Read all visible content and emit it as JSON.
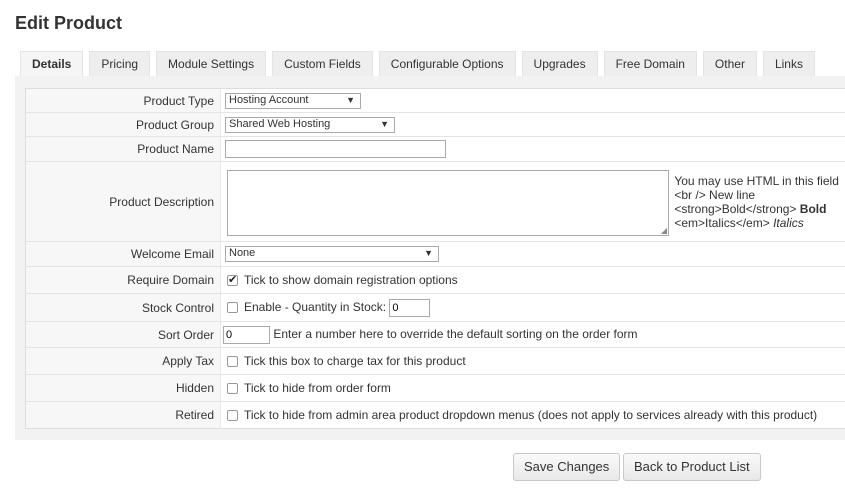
{
  "page": {
    "title": "Edit Product"
  },
  "tabs": [
    "Details",
    "Pricing",
    "Module Settings",
    "Custom Fields",
    "Configurable Options",
    "Upgrades",
    "Free Domain",
    "Other",
    "Links"
  ],
  "form": {
    "product_type": {
      "label": "Product Type",
      "value": "Hosting Account"
    },
    "product_group": {
      "label": "Product Group",
      "value": "Shared Web Hosting"
    },
    "product_name": {
      "label": "Product Name",
      "value": ""
    },
    "product_description": {
      "label": "Product Description",
      "value": "",
      "hint_line1": "You may use HTML in this field",
      "hint_line2": "<br /> New line",
      "hint_line3_code": "<strong>Bold</strong>",
      "hint_line3_bold": "Bold",
      "hint_line4_code": "<em>Italics</em>",
      "hint_line4_italic": "Italics"
    },
    "welcome_email": {
      "label": "Welcome Email",
      "value": "None"
    },
    "require_domain": {
      "label": "Require Domain",
      "checked": true,
      "text": "Tick to show domain registration options"
    },
    "stock_control": {
      "label": "Stock Control",
      "checked": false,
      "text": "Enable - Quantity in Stock:",
      "quantity": "0"
    },
    "sort_order": {
      "label": "Sort Order",
      "value": "0",
      "text": "Enter a number here to override the default sorting on the order form"
    },
    "apply_tax": {
      "label": "Apply Tax",
      "checked": false,
      "text": "Tick this box to charge tax for this product"
    },
    "hidden": {
      "label": "Hidden",
      "checked": false,
      "text": "Tick to hide from order form"
    },
    "retired": {
      "label": "Retired",
      "checked": false,
      "text": "Tick to hide from admin area product dropdown menus (does not apply to services already with this product)"
    }
  },
  "buttons": {
    "save": "Save Changes",
    "back": "Back to Product List"
  }
}
